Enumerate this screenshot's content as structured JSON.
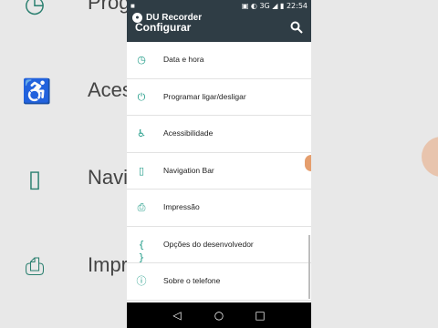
{
  "background": {
    "items": [
      {
        "icon": "schedule-icon",
        "label": "Progr"
      },
      {
        "icon": "accessibility-icon",
        "label": "Aces"
      },
      {
        "icon": "phone-outline-icon",
        "label": "Navi"
      },
      {
        "icon": "printer-icon",
        "label": "Impr"
      }
    ]
  },
  "status_bar": {
    "left_icon": "video-camera-icon",
    "network": "3G",
    "time": "22:54"
  },
  "recorder_overlay": {
    "label": "DU Recorder"
  },
  "toolbar": {
    "title": "Configurar",
    "search_icon": "search-icon"
  },
  "settings": {
    "items": [
      {
        "icon": "clock-icon",
        "label": "Data e hora"
      },
      {
        "icon": "power-icon",
        "label": "Programar ligar/desligar"
      },
      {
        "icon": "accessibility-icon",
        "label": "Acessibilidade"
      },
      {
        "icon": "phone-icon",
        "label": "Navigation Bar"
      },
      {
        "icon": "print-icon",
        "label": "Impressão"
      },
      {
        "icon": "code-braces-icon",
        "label": "Opções do desenvolvedor"
      },
      {
        "icon": "info-icon",
        "label": "Sobre o telefone"
      }
    ]
  },
  "nav_bar": {
    "back": "back-icon",
    "home": "home-icon",
    "recents": "recents-icon"
  },
  "colors": {
    "toolbar": "#2f3d45",
    "accent": "#1f9b87",
    "nav": "#000000"
  }
}
